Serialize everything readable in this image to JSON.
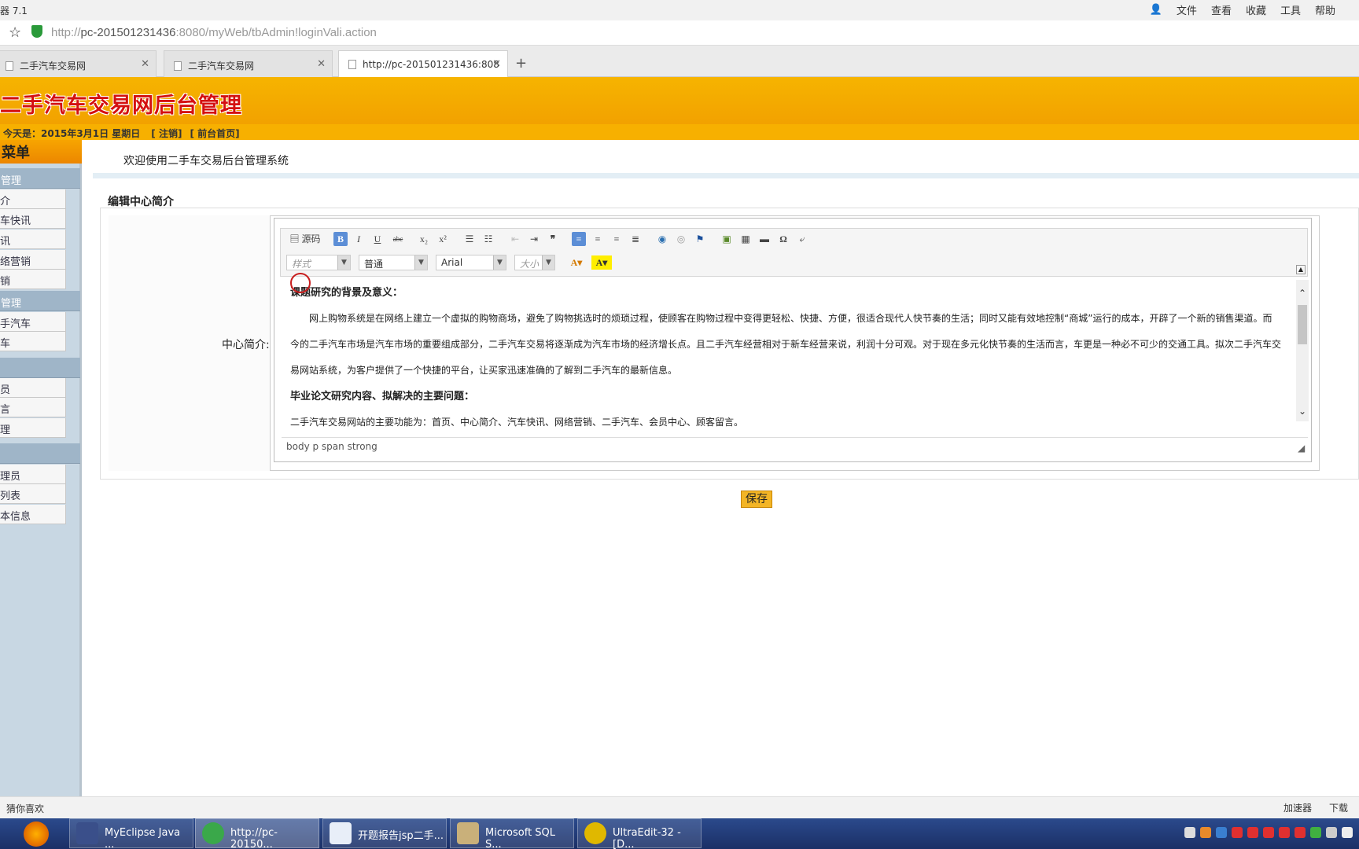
{
  "window": {
    "title": "器 7.1",
    "menu": [
      "文件",
      "查看",
      "收藏",
      "工具",
      "帮助"
    ]
  },
  "address": {
    "url_prefix": "http://",
    "url_host": "pc-201501231436",
    "url_rest": ":8080/myWeb/tbAdmin!loginVali.action"
  },
  "tabs": [
    {
      "label": "二手汽车交易网"
    },
    {
      "label": "二手汽车交易网"
    },
    {
      "label": "http://pc-201501231436:808"
    }
  ],
  "header": {
    "site_title": "二手汽车交易网后台管理",
    "date_text": "今天是：2015年3月1日 星期日",
    "logout": "[ 注销]",
    "home": "[ 前台首页]"
  },
  "sidebar": {
    "title": "菜单",
    "groups": [
      {
        "label": "管理",
        "items": [
          "介",
          "车快讯",
          "讯",
          "络营销",
          "销"
        ]
      },
      {
        "label": "管理",
        "items": [
          "手汽车",
          "车"
        ]
      },
      {
        "label": "",
        "items": [
          "员",
          "言",
          "理"
        ]
      },
      {
        "label": "",
        "items": [
          "理员",
          "列表",
          "本信息"
        ]
      }
    ]
  },
  "main": {
    "welcome": "欢迎使用二手车交易后台管理系统",
    "section_title": "编辑中心简介",
    "field_label": "中心简介:",
    "save": "保存"
  },
  "editor": {
    "toolbar": {
      "source": "源码",
      "bold": "B",
      "italic": "I",
      "underline": "U",
      "strike": "abc",
      "sub": "x₂",
      "sup": "x²",
      "style": "样式",
      "format": "普通",
      "font": "Arial",
      "size": "大小"
    },
    "content": [
      "课题研究的背景及意义：",
      "网上购物系统是在网络上建立一个虚拟的购物商场，避免了购物挑选时的烦琐过程，使顾客在购物过程中变得更轻松、快捷、方便，很适合现代人快节奏的生活；同时又能有效地控制“商城”运行的成本，开辟了一个新的销售渠道。而",
      "今的二手汽车市场是汽车市场的重要组成部分，二手汽车交易将逐渐成为汽车市场的经济增长点。且二手汽车经营相对于新车经营来说，利润十分可观。对于现在多元化快节奏的生活而言，车更是一种必不可少的交通工具。拟次二手汽车交",
      "易网站系统，为客户提供了一个快捷的平台，让买家迅速准确的了解到二手汽车的最新信息。",
      "毕业论文研究内容、拟解决的主要问题：",
      "二手汽车交易网站的主要功能为：首页、中心简介、汽车快讯、网络营销、二手汽车、会员中心、顾客留言。"
    ],
    "path": "body  p  span  strong"
  },
  "statusbar": {
    "left": "猜你喜欢",
    "right": [
      "加速器",
      "下载"
    ]
  },
  "taskbar": [
    "MyEclipse Java ...",
    "http://pc-20150...",
    "开题报告jsp二手...",
    "Microsoft SQL S...",
    "UltraEdit-32 - [D..."
  ],
  "colors": {
    "banner": "#f4a800",
    "title_red": "#d41010",
    "sidebar_group": "#9fb5c8",
    "taskbar": "#22407e"
  }
}
